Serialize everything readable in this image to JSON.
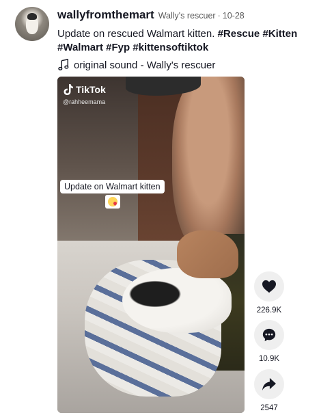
{
  "post": {
    "username": "wallyfromthemart",
    "nickname": "Wally's rescuer",
    "separator": "·",
    "date": "10-28",
    "caption_text": "Update on rescued Walmart kitten.",
    "hashtags": [
      "#Rescue",
      "#Kitten",
      "#Walmart",
      "#Fyp",
      "#kittensoftiktok"
    ],
    "music": "original sound - Wally's rescuer",
    "music_icon": "music-note-icon",
    "avatar": "avatar-kitten-photo"
  },
  "video": {
    "brand": "TikTok",
    "handle": "@rahheemama",
    "overlay_text": "Update on Walmart kitten",
    "overlay_emoji": "smiling-face-with-hearts-emoji"
  },
  "actions": {
    "like": {
      "icon": "heart-icon",
      "count": "226.9K"
    },
    "comment": {
      "icon": "comment-icon",
      "count": "10.9K"
    },
    "share": {
      "icon": "share-icon",
      "count": "2547"
    }
  },
  "colors": {
    "text": "#161823",
    "muted": "#5a5a5a",
    "action_bg": "#efefef"
  }
}
